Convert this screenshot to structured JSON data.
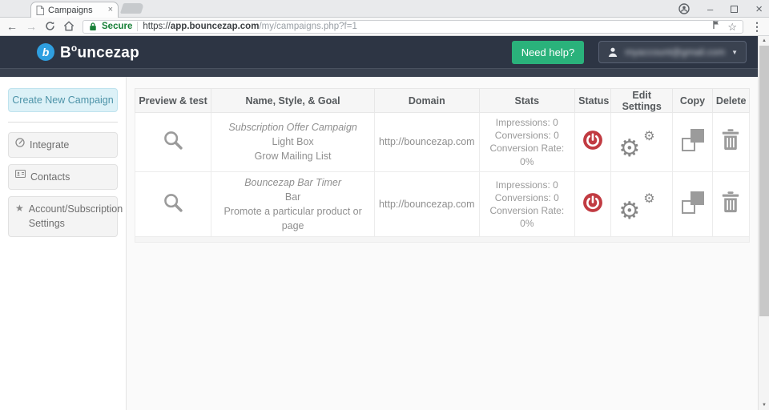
{
  "browser": {
    "tab_title": "Campaigns",
    "tab_close": "×",
    "secure_label": "Secure",
    "url_scheme": "https://",
    "url_host": "app.bouncezap.com",
    "url_path": "/my/campaigns.php?f=1",
    "back": "←",
    "forward": "→",
    "star": "☆",
    "menu": "⋮",
    "minimize": "–",
    "close": "×"
  },
  "scrollbar": {
    "up": "▲",
    "down": "▼"
  },
  "navbar": {
    "brand_b": "B",
    "brand_o": "o",
    "brand_rest": "uncezap",
    "need_help_label": "Need help?",
    "user_email_blurred": "myaccount@gmail.com",
    "caret": "▼"
  },
  "sidebar": {
    "create_button_label": "Create New Campaign",
    "items": [
      {
        "label": "Integrate"
      },
      {
        "label": "Contacts"
      },
      {
        "label": "Account/Subscription Settings"
      }
    ],
    "star_glyph": "★"
  },
  "table": {
    "headers": [
      "Preview & test",
      "Name, Style, & Goal",
      "Domain",
      "Stats",
      "Status",
      "Edit Settings",
      "Copy",
      "Delete"
    ],
    "gear_glyph": "⚙",
    "rows": [
      {
        "name": "Subscription Offer Campaign",
        "style": "Light Box",
        "goal": "Grow Mailing List",
        "domain": "http://bouncezap.com",
        "impressions": "Impressions: 0",
        "conversions": "Conversions: 0",
        "conversion_rate": "Conversion Rate: 0%"
      },
      {
        "name": "Bouncezap Bar Timer",
        "style": "Bar",
        "goal": "Promote a particular product or page",
        "domain": "http://bouncezap.com",
        "impressions": "Impressions: 0",
        "conversions": "Conversions: 0",
        "conversion_rate": "Conversion Rate: 0%"
      }
    ]
  },
  "colors": {
    "navbar_bg": "#2d3544",
    "need_help_green": "#2ab27b",
    "status_red": "#c13b42",
    "brand_blue": "#2f9fe0",
    "secure_green": "#188038",
    "create_button_bg": "#dcf1f7"
  }
}
